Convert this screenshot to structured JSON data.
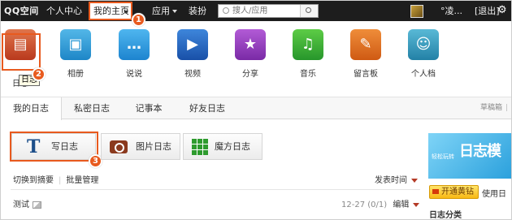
{
  "topbar": {
    "logo": "QQ空间",
    "personal_center": "个人中心",
    "my_home": "我的主页",
    "apps": "应用",
    "decorate": "装扮",
    "search_placeholder": "搜人/应用",
    "username": "°凌...",
    "logout": "[退出]"
  },
  "steps": [
    "1",
    "2",
    "3"
  ],
  "app_row": [
    {
      "label": "日志",
      "icon": "diary-icon"
    },
    {
      "label": "相册",
      "icon": "photo-album-icon"
    },
    {
      "label": "说说",
      "icon": "speech-bubble-icon"
    },
    {
      "label": "视频",
      "icon": "video-play-icon"
    },
    {
      "label": "分享",
      "icon": "share-star-icon"
    },
    {
      "label": "音乐",
      "icon": "music-note-icon"
    },
    {
      "label": "留言板",
      "icon": "message-board-icon"
    },
    {
      "label": "个人档",
      "icon": "profile-card-icon"
    }
  ],
  "tooltip": "日志",
  "tabs": [
    {
      "label": "我的日志"
    },
    {
      "label": "私密日志"
    },
    {
      "label": "记事本"
    },
    {
      "label": "好友日志"
    }
  ],
  "tab_right": {
    "drafts": "草稿箱",
    "sep": "|"
  },
  "write_buttons": [
    {
      "label": "写日志"
    },
    {
      "label": "图片日志"
    },
    {
      "label": "魔方日志"
    }
  ],
  "links": {
    "summary": "切换到摘要",
    "batch": "批量管理"
  },
  "sort": "发表时间",
  "entry": {
    "title": "测试",
    "date": "12-27",
    "count": "(0/1)",
    "edit": "编辑"
  },
  "right_panel": {
    "banner_small": "轻松玩转",
    "banner_big": "日志模",
    "vip_button": "开通黄钻",
    "vip_link": "使用日",
    "category": "日志分类"
  }
}
